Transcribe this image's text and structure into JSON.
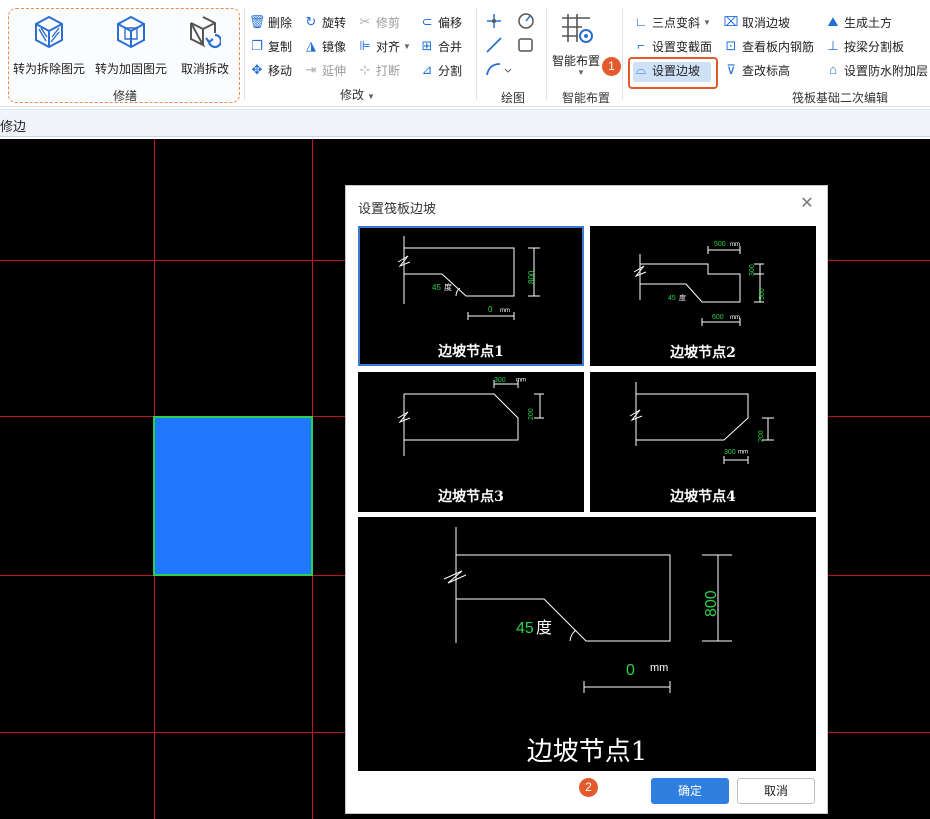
{
  "ribbon": {
    "repair_group": {
      "title": "修缮",
      "buttons": [
        {
          "label": "转为拆除图元",
          "icon": "cube-hatched-icon"
        },
        {
          "label": "转为加固图元",
          "icon": "cube-reinforce-icon"
        },
        {
          "label": "取消拆改",
          "icon": "cube-undo-icon"
        }
      ]
    },
    "modify_group": {
      "title": "修改",
      "col1": [
        {
          "label": "删除",
          "icon": "trash-icon",
          "enabled": true
        },
        {
          "label": "复制",
          "icon": "copy-icon",
          "enabled": true
        },
        {
          "label": "移动",
          "icon": "move-icon",
          "enabled": true
        }
      ],
      "col2": [
        {
          "label": "旋转",
          "icon": "rotate-icon",
          "enabled": true
        },
        {
          "label": "镜像",
          "icon": "mirror-icon",
          "enabled": true
        },
        {
          "label": "延伸",
          "icon": "extend-icon",
          "enabled": false
        }
      ],
      "col3": [
        {
          "label": "修剪",
          "icon": "trim-icon",
          "enabled": false
        },
        {
          "label": "对齐",
          "icon": "align-icon",
          "enabled": true
        },
        {
          "label": "打断",
          "icon": "break-icon",
          "enabled": false
        }
      ],
      "col4": [
        {
          "label": "偏移",
          "icon": "offset-icon",
          "enabled": true
        },
        {
          "label": "合并",
          "icon": "merge-icon",
          "enabled": true
        },
        {
          "label": "分割",
          "icon": "split-icon",
          "enabled": true
        }
      ]
    },
    "draw_group": {
      "title": "绘图"
    },
    "smart_group": {
      "title": "智能布置",
      "button_label": "智能布置"
    },
    "raft_group": {
      "title": "筏板基础二次编辑",
      "col1": [
        {
          "label": "三点变斜",
          "icon": "three-point-slope-icon"
        },
        {
          "label": "设置变截面",
          "icon": "variable-section-icon"
        },
        {
          "label": "设置边坡",
          "icon": "set-side-slope-icon"
        }
      ],
      "col2": [
        {
          "label": "取消边坡",
          "icon": "cancel-slope-icon"
        },
        {
          "label": "查看板内钢筋",
          "icon": "view-rebar-icon"
        },
        {
          "label": "查改标高",
          "icon": "edit-elevation-icon"
        }
      ],
      "col3": [
        {
          "label": "生成土方",
          "icon": "earthwork-icon"
        },
        {
          "label": "按梁分割板",
          "icon": "split-by-beam-icon"
        },
        {
          "label": "设置防水附加层",
          "icon": "waterproof-layer-icon"
        }
      ]
    },
    "badge1": "1"
  },
  "command_bar": {
    "text": "修边"
  },
  "dialog": {
    "title": "设置筏板边坡",
    "options": [
      {
        "caption": "边坡节点1",
        "selected": true,
        "angle_value": "45",
        "angle_unit": "度",
        "width_value": "0",
        "unit": "mm",
        "height_value": "800"
      },
      {
        "caption": "边坡节点2",
        "selected": false,
        "angle_value": "45",
        "angle_unit": "度",
        "top_value": "500",
        "bottom_value": "600",
        "unit": "mm",
        "height1_value": "300",
        "height2_value": "500"
      },
      {
        "caption": "边坡节点3",
        "selected": false,
        "top_value": "300",
        "unit": "mm",
        "height_value": "200"
      },
      {
        "caption": "边坡节点4",
        "selected": false,
        "bottom_value": "300",
        "unit": "mm",
        "height_value": "200"
      }
    ],
    "preview": {
      "caption": "边坡节点1",
      "angle_value": "45",
      "angle_unit": "度",
      "width_value": "0",
      "unit": "mm",
      "height_value": "800"
    },
    "ok_label": "确定",
    "cancel_label": "取消",
    "badge2": "2"
  },
  "colors": {
    "accent": "#2f7fe0",
    "highlight": "#e35b2c",
    "grid": "#c8141e",
    "slab": "#1f78ff",
    "dimension": "#2bd14a"
  }
}
